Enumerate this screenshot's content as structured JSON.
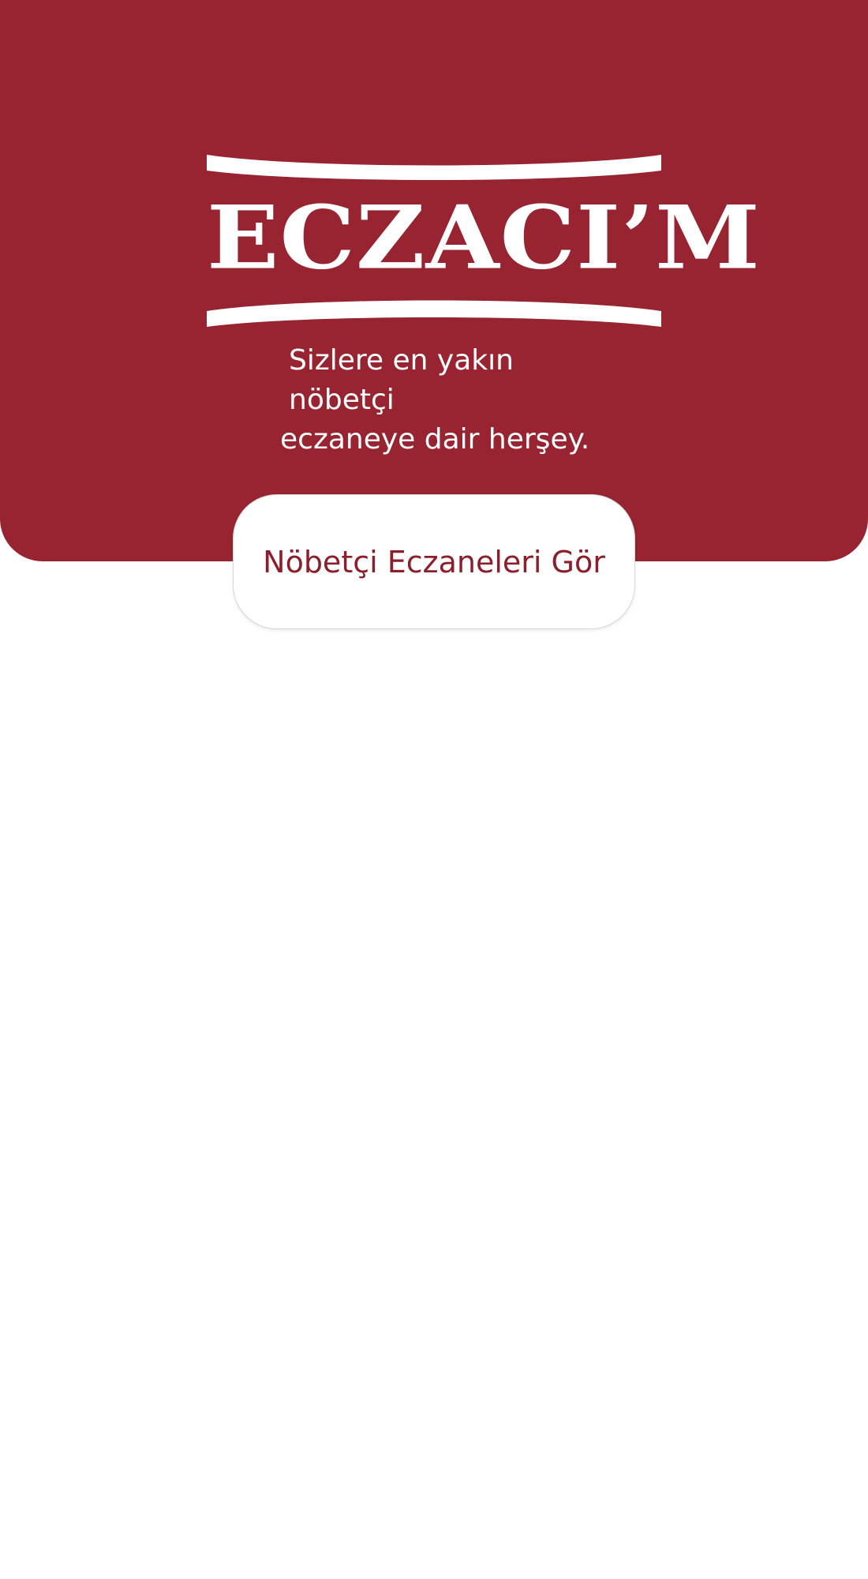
{
  "app": {
    "logo_text": "ECZACI’M",
    "tagline_line1": "Sizlere en yakın nöbetçi",
    "tagline_line2": "eczaneye dair herşey."
  },
  "actions": {
    "primary_button_label": "Nöbetçi Eczaneleri Gör"
  },
  "colors": {
    "brand": "#972430",
    "button_text": "#8b1f2c",
    "background": "#ffffff"
  }
}
